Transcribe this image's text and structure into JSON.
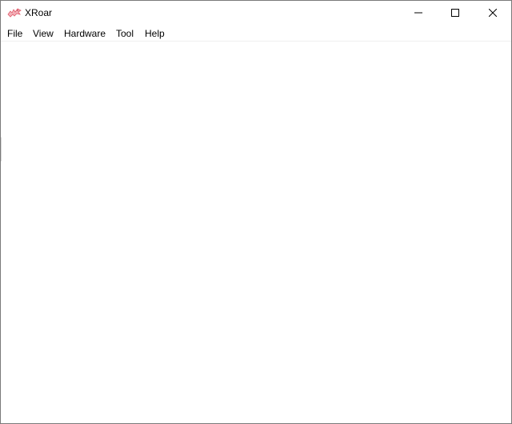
{
  "window": {
    "title": "XRoar",
    "app_icon": "xroar-dragon-icon"
  },
  "caption_buttons": {
    "minimize_icon": "minimize-icon",
    "maximize_icon": "maximize-icon",
    "close_icon": "close-icon"
  },
  "menubar": {
    "items": [
      {
        "label": "File"
      },
      {
        "label": "View"
      },
      {
        "label": "Hardware"
      },
      {
        "label": "Tool"
      },
      {
        "label": "Help"
      }
    ]
  },
  "colors": {
    "background": "#ffffff",
    "border": "#7a7a7a",
    "icon_accent": "#e05a6a"
  }
}
